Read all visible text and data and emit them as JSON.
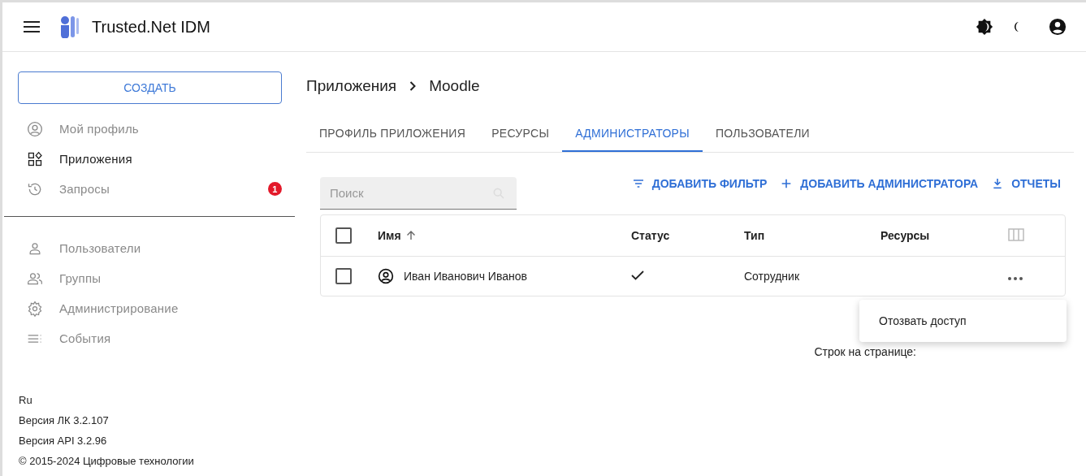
{
  "header": {
    "title": "Trusted.Net IDM"
  },
  "sidebar": {
    "create_button": "СОЗДАТЬ",
    "items": [
      {
        "label": "Мой профиль",
        "selected": false
      },
      {
        "label": "Приложения",
        "selected": true
      },
      {
        "label": "Запросы",
        "selected": false,
        "badge": "1"
      }
    ],
    "admin_items": [
      {
        "label": "Пользователи",
        "selected": false
      },
      {
        "label": "Группы",
        "selected": false
      },
      {
        "label": "Администрирование",
        "selected": false
      },
      {
        "label": "События",
        "selected": false
      }
    ],
    "footer": [
      "Ru",
      "Версия ЛК 3.2.107",
      "Версия API 3.2.96",
      "© 2015-2024 Цифровые технологии"
    ]
  },
  "breadcrumb": [
    "Приложения",
    "Moodle"
  ],
  "tabs": [
    {
      "label": "ПРОФИЛЬ ПРИЛОЖЕНИЯ",
      "selected": false
    },
    {
      "label": "РЕСУРСЫ",
      "selected": false
    },
    {
      "label": "АДМИНИСТРАТОРЫ",
      "selected": true
    },
    {
      "label": "ПОЛЬЗОВАТЕЛИ",
      "selected": false
    }
  ],
  "search": {
    "placeholder": "Поиск"
  },
  "actions": [
    {
      "label": "ДОБАВИТЬ ФИЛЬТР"
    },
    {
      "label": "ДОБАВИТЬ АДМИНИСТРАТОРА"
    },
    {
      "label": "ОТЧЕТЫ"
    }
  ],
  "table": {
    "all_checked": false,
    "columns": [
      "Имя",
      "Статус",
      "Тип",
      "Ресурсы"
    ],
    "rows": [
      {
        "checked": false,
        "name": "Иван Иванович Иванов",
        "active": true,
        "type": "Сотрудник"
      }
    ]
  },
  "row_menu": [
    "Отозвать доступ"
  ],
  "pagination": {
    "rows_label": "Строк на странице:"
  }
}
